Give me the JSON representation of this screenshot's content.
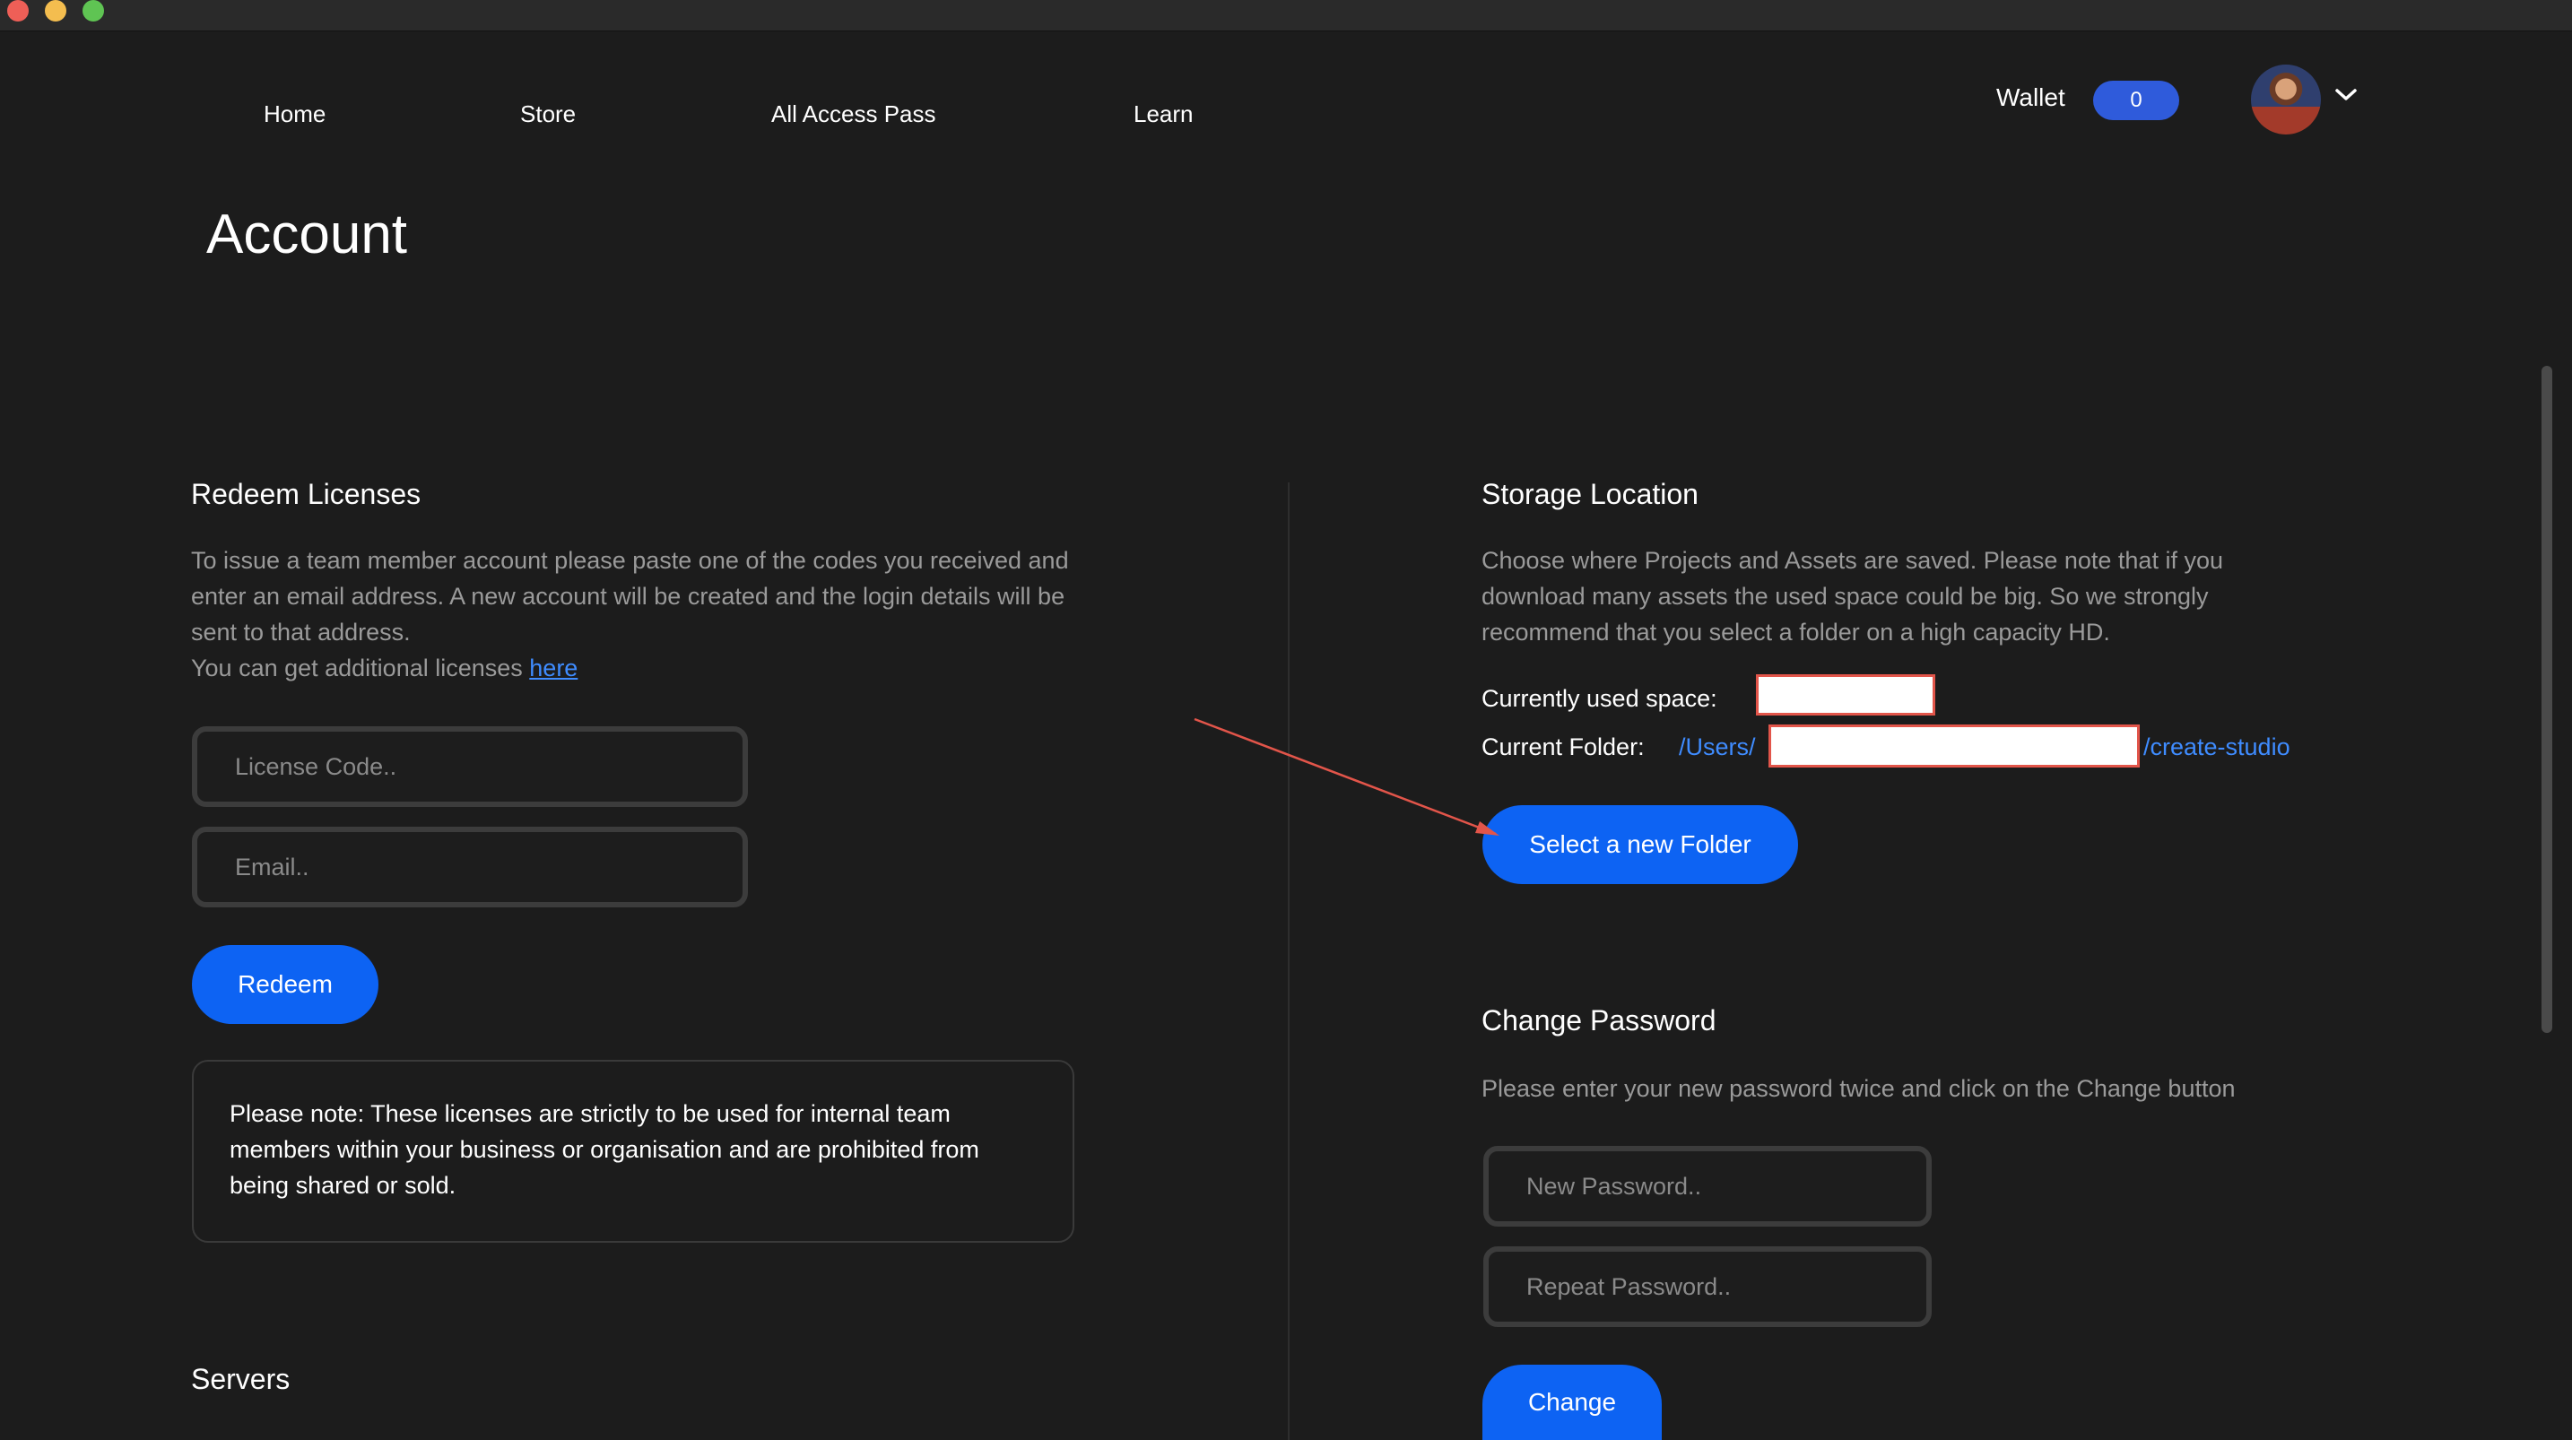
{
  "nav": {
    "items": [
      {
        "label": "Home"
      },
      {
        "label": "Store"
      },
      {
        "label": "All Access Pass"
      },
      {
        "label": "Learn"
      }
    ]
  },
  "wallet": {
    "label": "Wallet",
    "count": "0"
  },
  "user_menu": {
    "avatar_icon": "user-avatar",
    "chevron_icon": "chevron-down-icon"
  },
  "page": {
    "title": "Account"
  },
  "redeem": {
    "title": "Redeem Licenses",
    "description": "To issue a team member account please paste one of the codes you received and enter an email address. A new account will be created and the login details will be sent to that address.",
    "more_text": "You can get additional licenses ",
    "more_link": "here",
    "license_placeholder": "License Code..",
    "email_placeholder": "Email..",
    "button": "Redeem",
    "notice": "Please note: These licenses are strictly to be used for internal team members within your business or organisation and are prohibited from being shared or sold."
  },
  "servers": {
    "title": "Servers"
  },
  "storage": {
    "title": "Storage Location",
    "description": "Choose where Projects and Assets are saved. Please note that if you download many assets the used space could be big. So we strongly recommend that you select a folder on a high capacity HD.",
    "used_label": "Currently used space:",
    "folder_label": "Current Folder:",
    "path_prefix": "/Users/",
    "path_suffix": "/create-studio",
    "button": "Select a new Folder"
  },
  "password": {
    "title": "Change Password",
    "description": "Please enter your new password twice and click on the Change button",
    "new_placeholder": "New Password..",
    "repeat_placeholder": "Repeat Password..",
    "button": "Change"
  },
  "colors": {
    "background": "#1c1c1c",
    "accent": "#0d63f3",
    "link": "#3f8cff",
    "muted_text": "#9a9a9a",
    "annotation_arrow": "#e2554a"
  }
}
